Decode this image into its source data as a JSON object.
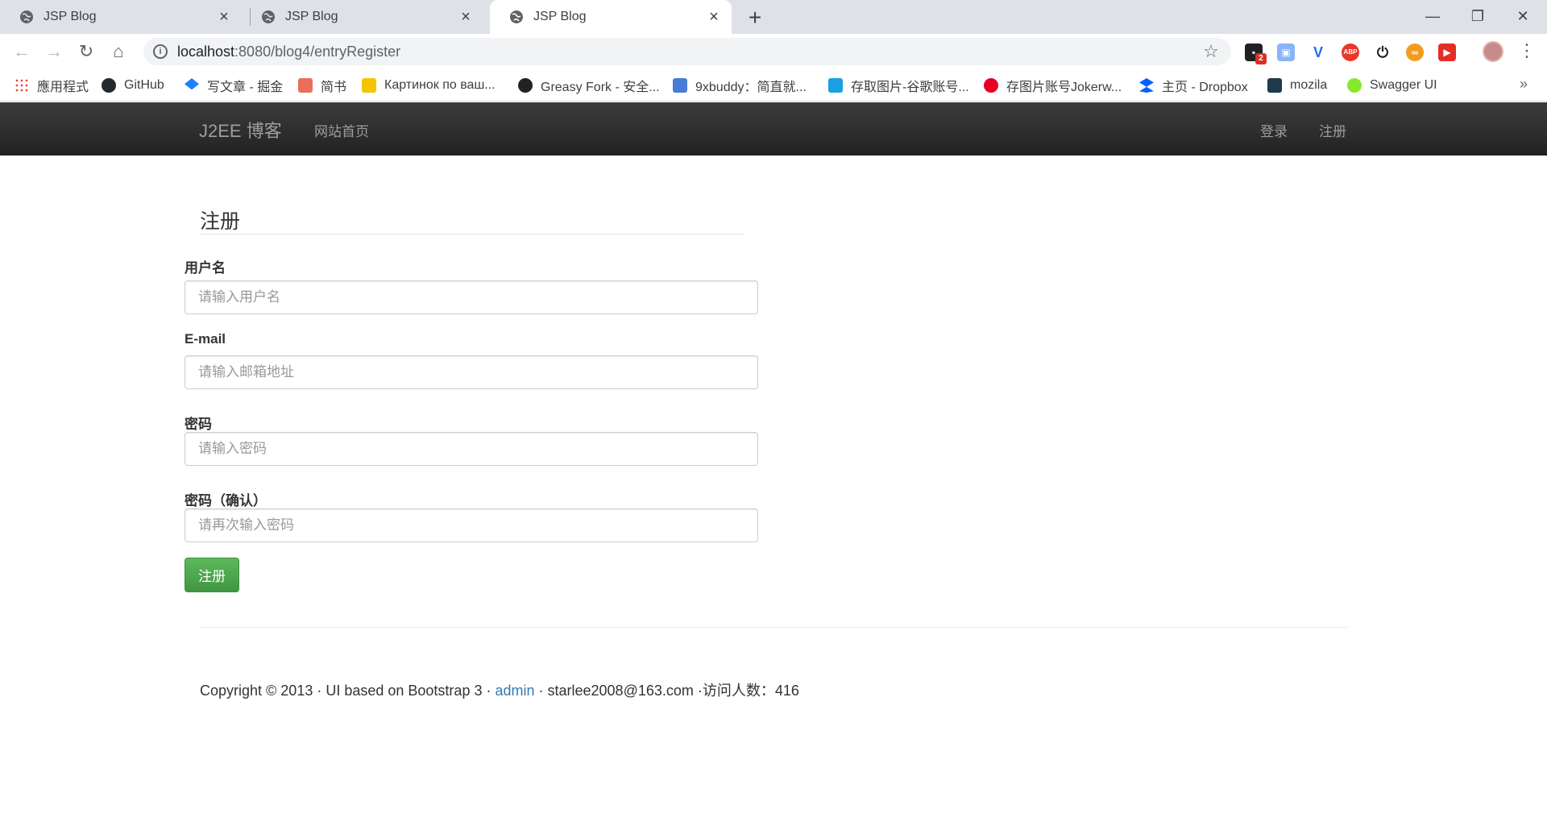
{
  "browser": {
    "tabs": [
      {
        "title": "JSP Blog",
        "active": false
      },
      {
        "title": "JSP Blog",
        "active": false
      },
      {
        "title": "JSP Blog",
        "active": true
      }
    ],
    "url_host": "localhost",
    "url_path": ":8080/blog4/entryRegister",
    "extension_badge": "2",
    "extension_abp": "ABP",
    "bookmarks": [
      {
        "label": "應用程式",
        "icon": "apps-icon",
        "color": "#4285f4"
      },
      {
        "label": "GitHub",
        "icon": "github-icon",
        "color": "#24292e"
      },
      {
        "label": "写文章 - 掘金",
        "icon": "juejin-icon",
        "color": "#1e80ff"
      },
      {
        "label": "简书",
        "icon": "jianshu-icon",
        "color": "#ea6f5a"
      },
      {
        "label": "Картинок по ваш...",
        "icon": "image-icon",
        "color": "#f5c400"
      },
      {
        "label": "Greasy Fork - 安全...",
        "icon": "greasyfork-icon",
        "color": "#222222"
      },
      {
        "label": "9xbuddy：简直就...",
        "icon": "doc-icon",
        "color": "#4a7bd6"
      },
      {
        "label": "存取图片-谷歌账号...",
        "icon": "ibb-icon",
        "color": "#1ba0e1"
      },
      {
        "label": "存图片账号Jokerw...",
        "icon": "pinterest-icon",
        "color": "#e60023"
      },
      {
        "label": "主页 - Dropbox",
        "icon": "dropbox-icon",
        "color": "#0061fe"
      },
      {
        "label": "mozila",
        "icon": "mozilla-icon",
        "color": "#1d3b4c"
      },
      {
        "label": "Swagger UI",
        "icon": "swagger-icon",
        "color": "#85ea2d"
      }
    ]
  },
  "navbar": {
    "brand": "J2EE 博客",
    "home": "网站首页",
    "login": "登录",
    "register": "注册"
  },
  "form": {
    "legend": "注册",
    "username_label": "用户名",
    "username_placeholder": "请输入用户名",
    "email_label": "E-mail",
    "email_placeholder": "请输入邮箱地址",
    "password_label": "密码",
    "password_placeholder": "请输入密码",
    "confirm_label": "密码（确认）",
    "confirm_placeholder": "请再次输入密码",
    "submit": "注册"
  },
  "footer": {
    "prefix": "Copyright © 2013 · UI based on Bootstrap 3 · ",
    "admin_link": "admin",
    "suffix": " · starlee2008@163.com ·访问人数：416"
  }
}
